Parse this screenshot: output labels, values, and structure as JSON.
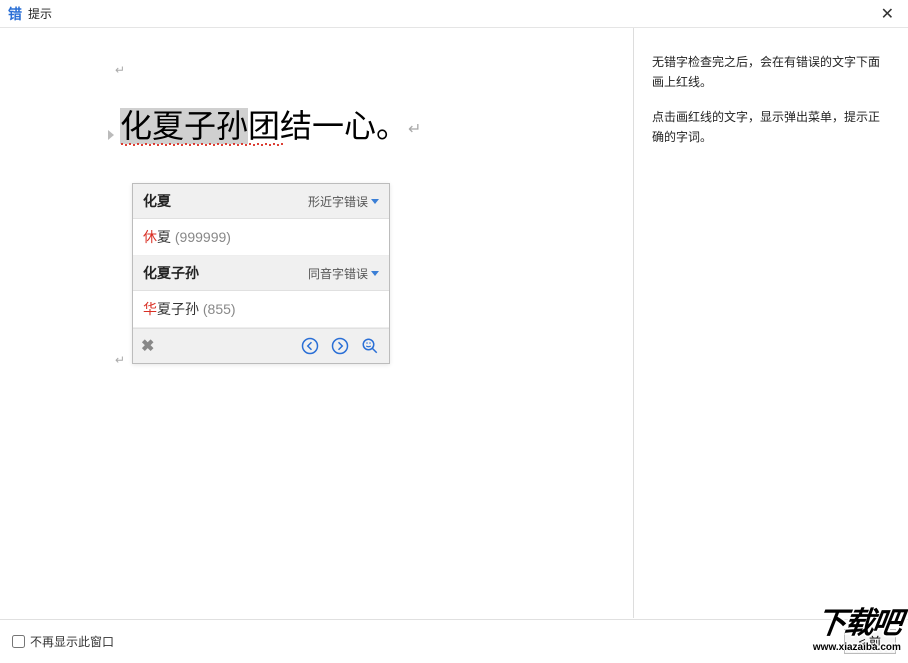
{
  "titlebar": {
    "app_icon_text": "错",
    "title": "提示"
  },
  "document": {
    "text_selected": "化夏子孙",
    "text_rest": "团结一心。"
  },
  "popup": {
    "group1": {
      "word": "化夏",
      "type": "形近字错误",
      "suggestion_correct": "休",
      "suggestion_rest": "夏",
      "suggestion_freq": "(999999)"
    },
    "group2": {
      "word": "化夏子孙",
      "type": "同音字错误",
      "suggestion_correct": "华",
      "suggestion_rest": "夏子孙",
      "suggestion_freq": "(855)"
    }
  },
  "help": {
    "para1": "无错字检查完之后，会在有错误的文字下面画上红线。",
    "para2": "点击画红线的文字，显示弹出菜单，提示正确的字词。"
  },
  "footer": {
    "checkbox_label": "不再显示此窗口",
    "prev_button": "< 前"
  },
  "watermark": {
    "main": "下载吧",
    "sub": "www.xiazaiba.com"
  }
}
